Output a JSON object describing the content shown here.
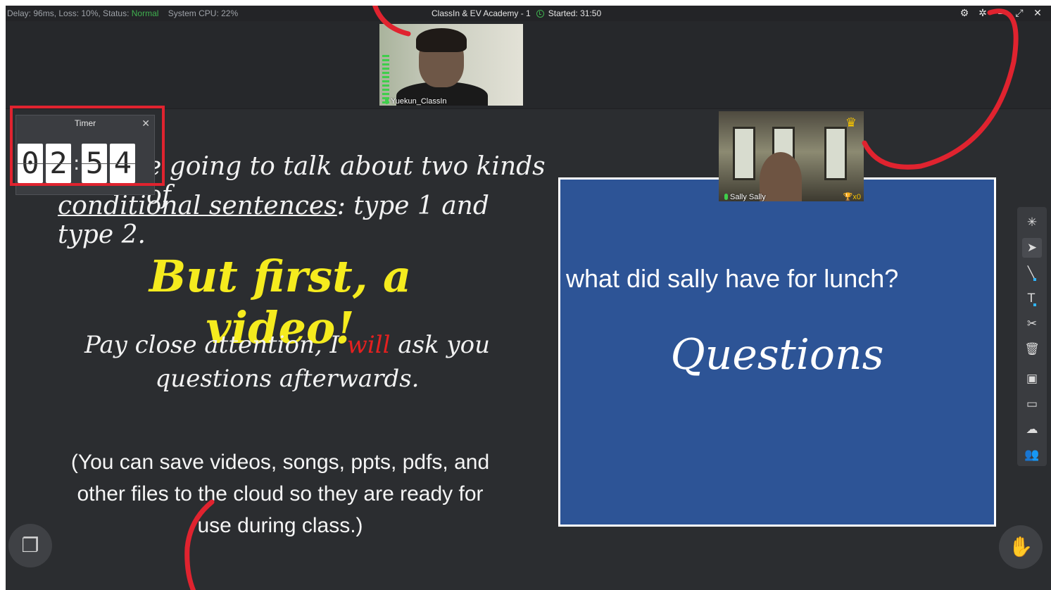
{
  "topbar": {
    "stats_prefix": "Delay: 96ms, Loss: 10%, Status: ",
    "status": "Normal",
    "cpu": "System CPU: 22%",
    "title": "ClassIn & EV Academy - 1",
    "started": "Started: 31:50",
    "controls": [
      "⚙",
      "✲",
      "–",
      "⤢",
      "✕"
    ]
  },
  "teacher": {
    "name": "Yuekun_ClassIn"
  },
  "timer": {
    "title": "Timer",
    "close": "✕",
    "digits": [
      "0",
      "2",
      "5",
      "4"
    ],
    "separator": ":"
  },
  "slide": {
    "line1": "e going to talk about two kinds of",
    "line2_underlined": "conditional sentences",
    "line2_rest": ": type 1 and type 2.",
    "line3": "But first, a video!",
    "line4_a": "Pay close attention, I ",
    "line4_red": "will",
    "line4_b": " ask you questions afterwards.",
    "line5": "(You can save videos, songs, ppts, pdfs, and other files to the cloud so they are ready for use during class.)"
  },
  "student": {
    "name": "Sally Sally",
    "trophies": "x0"
  },
  "blue_slide": {
    "question": "what did sally have for lunch?",
    "title": "Questions"
  },
  "toolbar": {
    "tools": [
      "laser-pointer",
      "select",
      "pen",
      "text",
      "scissors",
      "trash",
      "formula",
      "comment",
      "cloud",
      "students"
    ]
  },
  "colors": {
    "accent_red": "#e0232f",
    "status_green": "#3fb04f",
    "slide_blue": "#2d5496",
    "headline_yellow": "#f5eb1e"
  }
}
